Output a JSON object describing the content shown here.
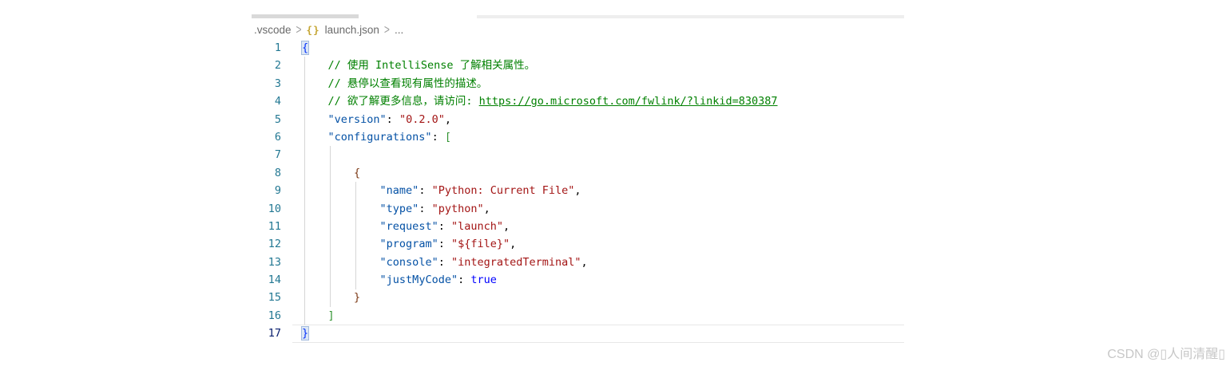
{
  "breadcrumb": {
    "folder": ".vscode",
    "separator": ">",
    "file_icon": "{}",
    "file": "launch.json",
    "tail": "..."
  },
  "editor": {
    "active_line": 17,
    "lines": [
      {
        "num": "1",
        "tokens": [
          {
            "t": "{",
            "c": "b1",
            "m": true
          }
        ]
      },
      {
        "num": "2",
        "tokens": [
          {
            "t": "    ",
            "c": "p"
          },
          {
            "t": "// 使用 IntelliSense 了解相关属性。",
            "c": "cm"
          }
        ]
      },
      {
        "num": "3",
        "tokens": [
          {
            "t": "    ",
            "c": "p"
          },
          {
            "t": "// 悬停以查看现有属性的描述。",
            "c": "cm"
          }
        ]
      },
      {
        "num": "4",
        "tokens": [
          {
            "t": "    ",
            "c": "p"
          },
          {
            "t": "// 欲了解更多信息，请访问: ",
            "c": "cm"
          },
          {
            "t": "https://go.microsoft.com/fwlink/?linkid=830387",
            "c": "lk",
            "link": true
          }
        ]
      },
      {
        "num": "5",
        "tokens": [
          {
            "t": "    ",
            "c": "p"
          },
          {
            "t": "\"version\"",
            "c": "k"
          },
          {
            "t": ": ",
            "c": "p"
          },
          {
            "t": "\"0.2.0\"",
            "c": "s"
          },
          {
            "t": ",",
            "c": "p"
          }
        ]
      },
      {
        "num": "6",
        "tokens": [
          {
            "t": "    ",
            "c": "p"
          },
          {
            "t": "\"configurations\"",
            "c": "k"
          },
          {
            "t": ": ",
            "c": "p"
          },
          {
            "t": "[",
            "c": "b2"
          }
        ]
      },
      {
        "num": "7",
        "tokens": []
      },
      {
        "num": "8",
        "tokens": [
          {
            "t": "        ",
            "c": "p"
          },
          {
            "t": "{",
            "c": "b3"
          }
        ]
      },
      {
        "num": "9",
        "tokens": [
          {
            "t": "            ",
            "c": "p"
          },
          {
            "t": "\"name\"",
            "c": "k"
          },
          {
            "t": ": ",
            "c": "p"
          },
          {
            "t": "\"Python: Current File\"",
            "c": "s"
          },
          {
            "t": ",",
            "c": "p"
          }
        ]
      },
      {
        "num": "10",
        "tokens": [
          {
            "t": "            ",
            "c": "p"
          },
          {
            "t": "\"type\"",
            "c": "k"
          },
          {
            "t": ": ",
            "c": "p"
          },
          {
            "t": "\"python\"",
            "c": "s"
          },
          {
            "t": ",",
            "c": "p"
          }
        ]
      },
      {
        "num": "11",
        "tokens": [
          {
            "t": "            ",
            "c": "p"
          },
          {
            "t": "\"request\"",
            "c": "k"
          },
          {
            "t": ": ",
            "c": "p"
          },
          {
            "t": "\"launch\"",
            "c": "s"
          },
          {
            "t": ",",
            "c": "p"
          }
        ]
      },
      {
        "num": "12",
        "tokens": [
          {
            "t": "            ",
            "c": "p"
          },
          {
            "t": "\"program\"",
            "c": "k"
          },
          {
            "t": ": ",
            "c": "p"
          },
          {
            "t": "\"${file}\"",
            "c": "s"
          },
          {
            "t": ",",
            "c": "p"
          }
        ]
      },
      {
        "num": "13",
        "tokens": [
          {
            "t": "            ",
            "c": "p"
          },
          {
            "t": "\"console\"",
            "c": "k"
          },
          {
            "t": ": ",
            "c": "p"
          },
          {
            "t": "\"integratedTerminal\"",
            "c": "s"
          },
          {
            "t": ",",
            "c": "p"
          }
        ]
      },
      {
        "num": "14",
        "tokens": [
          {
            "t": "            ",
            "c": "p"
          },
          {
            "t": "\"justMyCode\"",
            "c": "k"
          },
          {
            "t": ": ",
            "c": "p"
          },
          {
            "t": "true",
            "c": "kw"
          }
        ]
      },
      {
        "num": "15",
        "tokens": [
          {
            "t": "        ",
            "c": "p"
          },
          {
            "t": "}",
            "c": "b3"
          }
        ]
      },
      {
        "num": "16",
        "tokens": [
          {
            "t": "    ",
            "c": "p"
          },
          {
            "t": "]",
            "c": "b2"
          }
        ]
      },
      {
        "num": "17",
        "tokens": [
          {
            "t": "}",
            "c": "b1",
            "m": true
          }
        ]
      }
    ]
  },
  "watermark": "CSDN @▯人间清醒▯",
  "palette": {
    "comment": "#008000",
    "property_key": "#0451a5",
    "string_value": "#a31515",
    "keyword": "#0000ff",
    "bracket_level1": "#0431fa",
    "bracket_level2": "#319331",
    "bracket_level3": "#7b3814",
    "line_number": "#237893",
    "active_line_number": "#0b216f",
    "json_file_icon": "#c5a634"
  }
}
